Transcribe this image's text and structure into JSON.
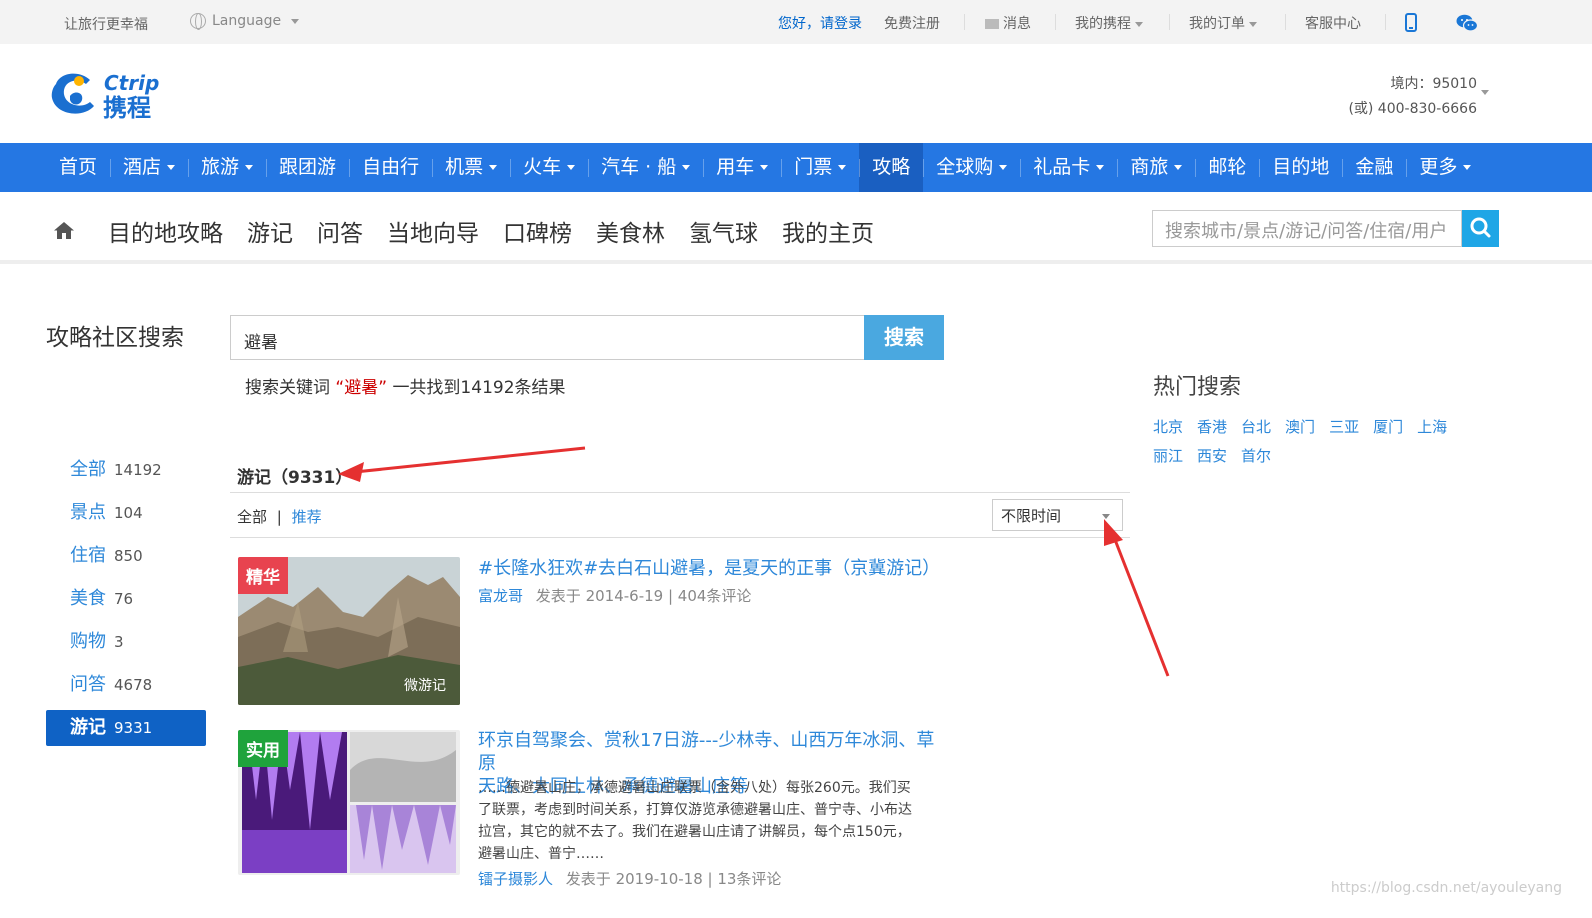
{
  "topbar": {
    "slogan": "让旅行更幸福",
    "language": "Language",
    "login": "您好，请登录",
    "register": "免费注册",
    "messages": "消息",
    "my_ctrip": "我的携程",
    "my_orders": "我的订单",
    "service": "客服中心"
  },
  "header": {
    "hotline_domestic": "境内：95010",
    "hotline_alt": "(或) 400-830-6666"
  },
  "mainnav": [
    {
      "label": "首页"
    },
    {
      "label": "酒店"
    },
    {
      "label": "旅游"
    },
    {
      "label": "跟团游"
    },
    {
      "label": "自由行"
    },
    {
      "label": "机票"
    },
    {
      "label": "火车"
    },
    {
      "label": "汽车 · 船"
    },
    {
      "label": "用车"
    },
    {
      "label": "门票"
    },
    {
      "label": "攻略"
    },
    {
      "label": "全球购"
    },
    {
      "label": "礼品卡"
    },
    {
      "label": "商旅"
    },
    {
      "label": "邮轮"
    },
    {
      "label": "目的地"
    },
    {
      "label": "金融"
    },
    {
      "label": "更多"
    }
  ],
  "subnav": {
    "items": [
      "目的地攻略",
      "游记",
      "问答",
      "当地向导",
      "口碑榜",
      "美食林",
      "氢气球",
      "我的主页"
    ],
    "search_placeholder": "搜索城市/景点/游记/问答/住宿/用户"
  },
  "search": {
    "page_title": "攻略社区搜索",
    "keyword": "避暑",
    "button": "搜索",
    "summary_prefix": "搜索关键词",
    "summary_keyword": "“避暑”",
    "summary_suffix": "一共找到14192条结果"
  },
  "categories": [
    {
      "name": "全部",
      "count": "14192"
    },
    {
      "name": "景点",
      "count": "104"
    },
    {
      "name": "住宿",
      "count": "850"
    },
    {
      "name": "美食",
      "count": "76"
    },
    {
      "name": "购物",
      "count": "3"
    },
    {
      "name": "问答",
      "count": "4678"
    },
    {
      "name": "游记",
      "count": "9331"
    }
  ],
  "section": {
    "heading": "游记（9331）",
    "filter_all": "全部",
    "filter_sep": "|",
    "filter_recommended": "推荐",
    "time_select": "不限时间"
  },
  "articles": [
    {
      "tag": "精华",
      "badge": "微游记",
      "title": "#长隆水狂欢#去白石山避暑，是夏天的正事（京冀游记）",
      "author": "富龙哥",
      "meta": "发表于  2014-6-19  |  404条评论"
    },
    {
      "tag": "实用",
      "title_line1": "环京自驾聚会、赏秋17日游---少林寺、山西万年冰洞、草原",
      "title_line2": "天路、大同土林、承德避暑山庄等",
      "excerpt_1": "……德避暑山庄，承德避暑山庄联票（含外八处）每张260元。我们买",
      "excerpt_2": "了联票，考虑到时间关系，打算仅游览承德避暑山庄、普宁寺、小布达",
      "excerpt_3": "拉宫，其它的就不去了。我们在避暑山庄请了讲解员，每个点150元，",
      "excerpt_4": "避暑山庄、普宁……",
      "author": "镭子摄影人",
      "meta": "发表于  2019-10-18  |  13条评论"
    }
  ],
  "hot_search": {
    "title": "热门搜索",
    "items": [
      "北京",
      "香港",
      "台北",
      "澳门",
      "三亚",
      "厦门",
      "上海",
      "丽江",
      "西安",
      "首尔"
    ]
  },
  "watermark": "https://blog.csdn.net/ayouleyang",
  "colors": {
    "nav_blue": "#2577e3",
    "link_blue": "#2e88d9",
    "tag_red": "#e8434f",
    "tag_green": "#1fa33c",
    "annotation_red": "#e53030"
  }
}
